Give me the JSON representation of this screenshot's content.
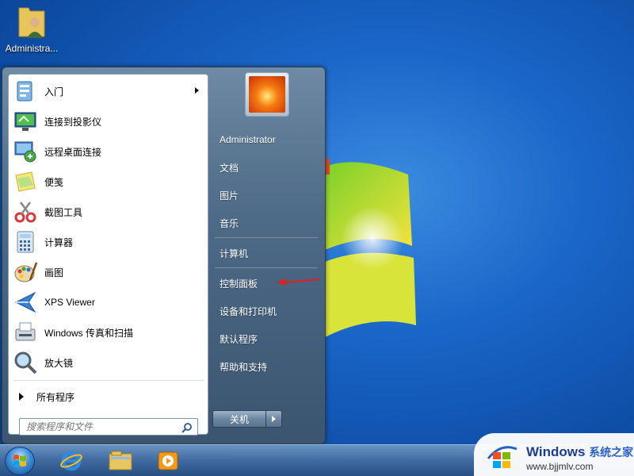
{
  "desktop": {
    "icon_label": "Administra..."
  },
  "start_menu": {
    "programs": [
      {
        "label": "入门",
        "icon": "getting-started-icon",
        "has_submenu": true
      },
      {
        "label": "连接到投影仪",
        "icon": "projector-icon",
        "has_submenu": false
      },
      {
        "label": "远程桌面连接",
        "icon": "remote-desktop-icon",
        "has_submenu": false
      },
      {
        "label": "便笺",
        "icon": "sticky-notes-icon",
        "has_submenu": false
      },
      {
        "label": "截图工具",
        "icon": "snipping-tool-icon",
        "has_submenu": false
      },
      {
        "label": "计算器",
        "icon": "calculator-icon",
        "has_submenu": false
      },
      {
        "label": "画图",
        "icon": "paint-icon",
        "has_submenu": false
      },
      {
        "label": "XPS Viewer",
        "icon": "xps-viewer-icon",
        "has_submenu": false
      },
      {
        "label": "Windows 传真和扫描",
        "icon": "fax-scan-icon",
        "has_submenu": false
      },
      {
        "label": "放大镜",
        "icon": "magnifier-icon",
        "has_submenu": false
      }
    ],
    "all_programs_label": "所有程序",
    "search_placeholder": "搜索程序和文件",
    "right_items": [
      {
        "label": "Administrator"
      },
      {
        "label": "文档"
      },
      {
        "label": "图片"
      },
      {
        "label": "音乐"
      },
      {
        "label": "计算机"
      },
      {
        "label": "控制面板"
      },
      {
        "label": "设备和打印机"
      },
      {
        "label": "默认程序"
      },
      {
        "label": "帮助和支持"
      }
    ],
    "shutdown_label": "关机"
  },
  "taskbar": {
    "apps": [
      "internet-explorer-icon",
      "file-explorer-icon",
      "media-player-icon"
    ]
  },
  "watermark": {
    "brand": "Windows",
    "brand_cn": "系统之家",
    "url": "www.bjjmlv.com"
  },
  "colors": {
    "desktop_blue": "#1a66c8",
    "start_menu": "#4d6a86",
    "highlight_arrow": "#e0201c"
  }
}
